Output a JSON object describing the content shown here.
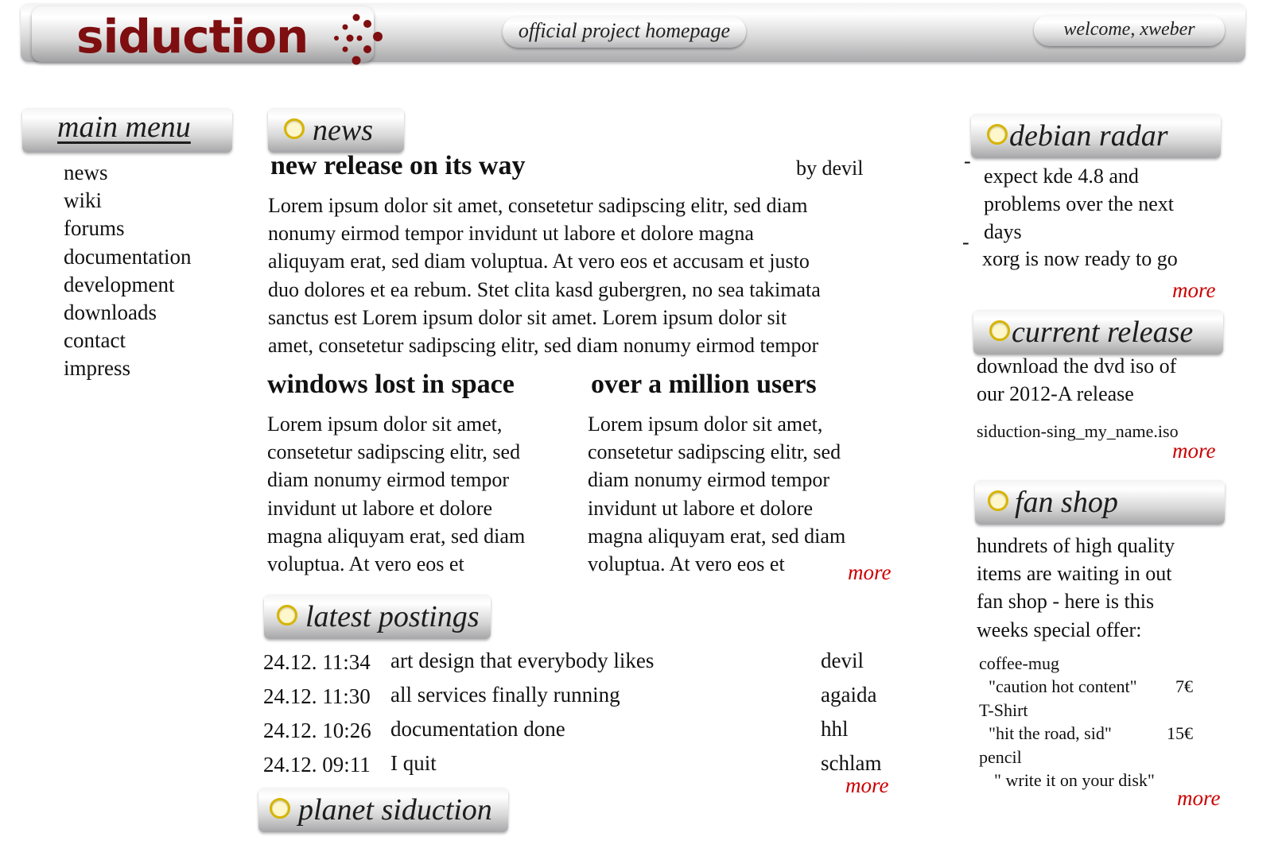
{
  "header": {
    "logo_text": "siduction",
    "tagline": "official project homepage",
    "welcome": "welcome, xweber"
  },
  "sidebar": {
    "title": "main menu",
    "items": [
      {
        "label": "news"
      },
      {
        "label": "wiki"
      },
      {
        "label": "forums"
      },
      {
        "label": "documentation"
      },
      {
        "label": "development"
      },
      {
        "label": "downloads"
      },
      {
        "label": "contact"
      },
      {
        "label": "impress"
      }
    ]
  },
  "news": {
    "section_title": "news",
    "lead": {
      "title": "new release on its way",
      "byline": "by devil",
      "lines": [
        "Lorem ipsum dolor sit amet, consetetur sadipscing elitr, sed diam",
        "nonumy eirmod tempor invidunt ut labore et dolore magna",
        "aliquyam erat, sed diam voluptua. At vero eos et accusam et justo",
        "duo dolores et ea rebum. Stet clita kasd gubergren, no sea takimata",
        "sanctus est Lorem ipsum dolor sit amet. Lorem ipsum dolor sit",
        "amet, consetetur sadipscing elitr, sed diam nonumy eirmod tempor"
      ]
    },
    "col1": {
      "title": "windows lost in space",
      "lines": [
        "Lorem ipsum dolor sit amet,",
        "consetetur sadipscing elitr, sed",
        "diam nonumy eirmod tempor",
        "invidunt ut labore et dolore",
        "magna aliquyam erat, sed diam",
        "voluptua. At vero eos et"
      ]
    },
    "col2": {
      "title": "over a million users",
      "lines": [
        "Lorem ipsum dolor sit amet,",
        "consetetur sadipscing elitr, sed",
        "diam nonumy eirmod tempor",
        "invidunt ut labore et dolore",
        "magna aliquyam erat, sed diam",
        "voluptua. At vero eos et"
      ]
    },
    "more": "more"
  },
  "postings": {
    "section_title": "latest postings",
    "rows": [
      {
        "time": "24.12. 11:34",
        "title": "art design that everybody likes",
        "author": "devil"
      },
      {
        "time": "24.12. 11:30",
        "title": "all services finally running",
        "author": "agaida"
      },
      {
        "time": "24.12. 10:26",
        "title": "documentation done",
        "author": "hhl"
      },
      {
        "time": "24.12. 09:11",
        "title": "I quit",
        "author": "schlam"
      }
    ],
    "more": "more"
  },
  "planet": {
    "section_title": "planet siduction"
  },
  "debian_radar": {
    "section_title": "debian radar",
    "items": [
      {
        "lines": [
          "expect kde 4.8 and",
          "problems over the next",
          "days"
        ]
      },
      {
        "lines": [
          "xorg is now ready to go"
        ]
      }
    ],
    "more": "more"
  },
  "current_release": {
    "section_title": "current release",
    "lines": [
      "download the dvd iso of",
      "our 2012-A release"
    ],
    "filename": "siduction-sing_my_name.iso",
    "more": "more"
  },
  "fan_shop": {
    "section_title": "fan shop",
    "intro_lines": [
      "hundrets of high quality",
      "items are waiting in out",
      "fan shop - here is this",
      "weeks special offer:"
    ],
    "items": [
      {
        "name": "coffee-mug",
        "desc": "\"caution hot content\"",
        "price": "7€"
      },
      {
        "name": "T-Shirt",
        "desc": "\"hit the road, sid\"",
        "price": "15€"
      },
      {
        "name": "pencil",
        "desc": "\" write it on your disk\"",
        "price": ""
      }
    ],
    "more": "more"
  },
  "colors": {
    "brand": "#7e0e10",
    "link_more": "#cc0000",
    "bullet_ring": "#d6b400"
  },
  "icons": [
    "siduction-dots-logo",
    "ring-bullet-icon"
  ]
}
